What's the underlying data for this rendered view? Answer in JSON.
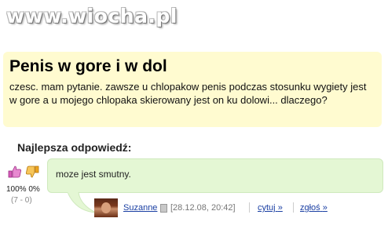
{
  "watermark": {
    "text": "www.wiocha.pl"
  },
  "question": {
    "title": "Penis w gore i w dol",
    "body": "czesc. mam pytanie. zawsze u chlopakow penis podczas stosunku wygiety jest w gore a u mojego chlopaka skierowany jest on ku dolowi... dlaczego?"
  },
  "best_answer": {
    "heading": "Najlepsza odpowiedź:",
    "votes_percent": "100% 0%",
    "votes_count": "(7 - 0)",
    "text": "moze jest smutny.",
    "author": "Suzanne",
    "date": "[28.12.08, 20:42]",
    "quote_label": "cytuj",
    "report_label": "zgłoś",
    "arrow": "»"
  },
  "colors": {
    "question_bg": "#fffbd0",
    "answer_bg": "#e4f7d4",
    "link": "#1a3fa3",
    "thumb_up": "#d65bb8",
    "thumb_down": "#f0a61e"
  },
  "icons": {
    "thumb_up": "thumbs-up-icon",
    "thumb_down": "thumbs-down-icon",
    "user": "user-icon"
  }
}
